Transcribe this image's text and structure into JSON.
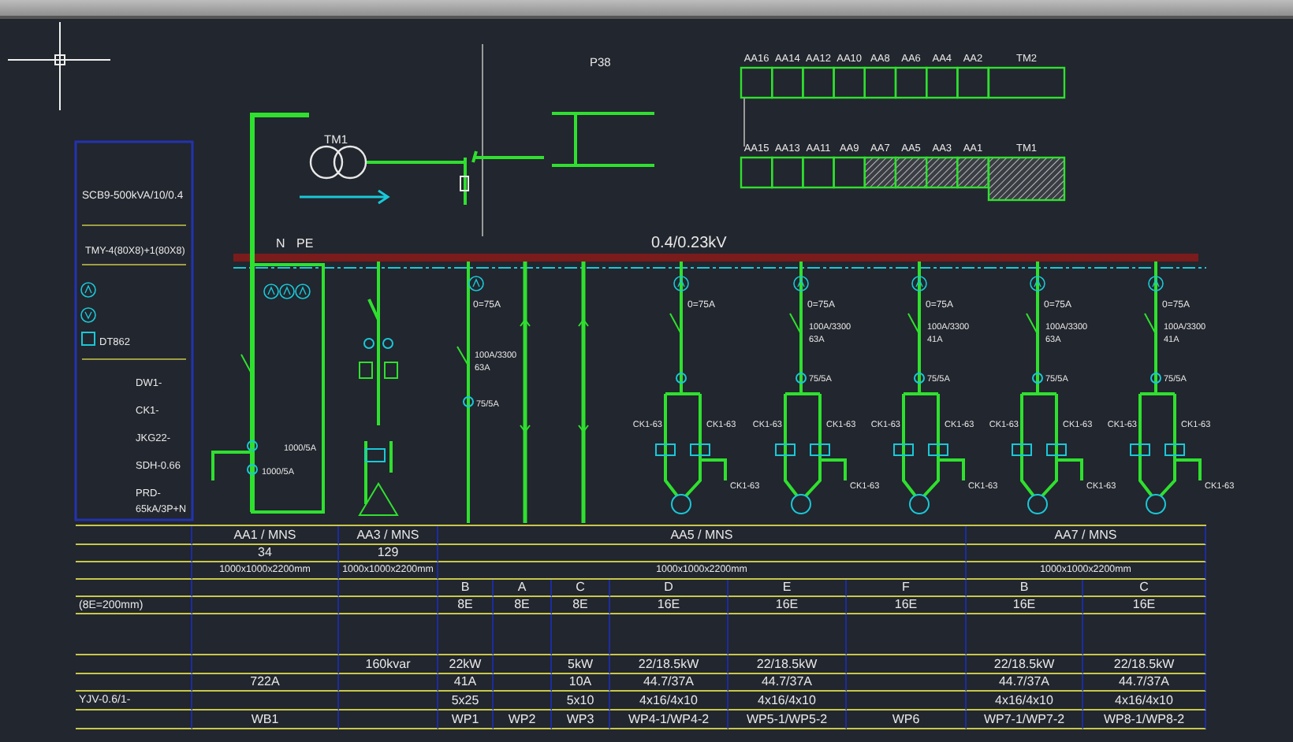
{
  "hv_section": {
    "transformer_label": "TM1",
    "reference": "P38"
  },
  "legend": {
    "transformer": "SCB9-500kVA/10/0.4",
    "busbar": "TMY-4(80X8)+1(80X8)",
    "meter": "DT862",
    "devices": [
      "DW1-",
      "CK1-",
      "JKG22-",
      "SDH-0.66",
      "PRD-"
    ],
    "surge_rating": "65kA/3P+N"
  },
  "busbar": {
    "voltage": "0.4/0.23kV",
    "neutral": "N",
    "earth": "PE"
  },
  "layout_plan": {
    "top_row": [
      {
        "label": "AA16",
        "hatched": false
      },
      {
        "label": "AA14",
        "hatched": false
      },
      {
        "label": "AA12",
        "hatched": false
      },
      {
        "label": "AA10",
        "hatched": false
      },
      {
        "label": "AA8",
        "hatched": false
      },
      {
        "label": "AA6",
        "hatched": false
      },
      {
        "label": "AA4",
        "hatched": false
      },
      {
        "label": "AA2",
        "hatched": false
      },
      {
        "label": "TM2",
        "hatched": false
      }
    ],
    "bottom_row": [
      {
        "label": "AA15",
        "hatched": false
      },
      {
        "label": "AA13",
        "hatched": false
      },
      {
        "label": "AA11",
        "hatched": false
      },
      {
        "label": "AA9",
        "hatched": false
      },
      {
        "label": "AA7",
        "hatched": true
      },
      {
        "label": "AA5",
        "hatched": true
      },
      {
        "label": "AA3",
        "hatched": true
      },
      {
        "label": "AA1",
        "hatched": true
      },
      {
        "label": "TM1",
        "hatched": true
      }
    ]
  },
  "feeders": [
    {
      "kind": "incomer",
      "ct_labels": [
        "1000/5A",
        "1000/5A"
      ]
    },
    {
      "kind": "capacitor"
    },
    {
      "kind": "feeder",
      "reading": "0=75A",
      "breaker": "100A/3300",
      "rating": "63A",
      "ct": "75/5A"
    },
    {
      "kind": "riser"
    },
    {
      "kind": "riser"
    },
    {
      "kind": "motor",
      "reading": "0=75A",
      "contactors": [
        "CK1-63",
        "CK1-63"
      ],
      "bypass": "CK1-63"
    },
    {
      "kind": "motor",
      "reading": "0=75A",
      "breaker": "100A/3300",
      "rating": "63A",
      "ct": "75/5A",
      "contactors": [
        "CK1-63",
        "CK1-63"
      ],
      "bypass": "CK1-63"
    },
    {
      "kind": "motor",
      "reading": "0=75A",
      "breaker": "100A/3300",
      "rating": "41A",
      "ct": "75/5A",
      "contactors": [
        "CK1-63",
        "CK1-63"
      ],
      "bypass": "CK1-63"
    },
    {
      "kind": "motor",
      "reading": "0=75A",
      "breaker": "100A/3300",
      "rating": "63A",
      "ct": "75/5A",
      "contactors": [
        "CK1-63",
        "CK1-63"
      ],
      "bypass": "CK1-63"
    },
    {
      "kind": "motor",
      "reading": "0=75A",
      "breaker": "100A/3300",
      "rating": "41A",
      "ct": "75/5A",
      "contactors": [
        "CK1-63",
        "CK1-63"
      ],
      "bypass": "CK1-63"
    }
  ],
  "table": {
    "width_label": "(8E=200mm)",
    "cable_label": "YJV-0.6/1-",
    "panels": [
      {
        "name": "AA1 / MNS",
        "number": "34",
        "size": "1000x1000x2200mm",
        "circuits": [
          {
            "current": "722A",
            "cable_no": "WB1"
          }
        ]
      },
      {
        "name": "AA3 / MNS",
        "number": "129",
        "size": "1000x1000x2200mm",
        "circuits": [
          {
            "power": "160kvar"
          }
        ]
      },
      {
        "name": "AA5 / MNS",
        "size": "1000x1000x2200mm",
        "circuits": [
          {
            "drawer": "B",
            "width": "8E",
            "power": "22kW",
            "current": "41A",
            "cable": "5x25",
            "cable_no": "WP1"
          },
          {
            "drawer": "A",
            "width": "8E",
            "cable_no": "WP2"
          },
          {
            "drawer": "C",
            "width": "8E",
            "power": "5kW",
            "current": "10A",
            "cable": "5x10",
            "cable_no": "WP3"
          },
          {
            "drawer": "D",
            "width": "16E",
            "power": "22/18.5kW",
            "current": "44.7/37A",
            "cable": "4x16/4x10",
            "cable_no": "WP4-1/WP4-2"
          },
          {
            "drawer": "E",
            "width": "16E",
            "power": "22/18.5kW",
            "current": "44.7/37A",
            "cable": "4x16/4x10",
            "cable_no": "WP5-1/WP5-2"
          },
          {
            "drawer": "F",
            "width": "16E",
            "cable_no": "WP6"
          }
        ]
      },
      {
        "name": "AA7 / MNS",
        "size": "1000x1000x2200mm",
        "circuits": [
          {
            "drawer": "B",
            "width": "16E",
            "power": "22/18.5kW",
            "current": "44.7/37A",
            "cable": "4x16/4x10",
            "cable_no": "WP7-1/WP7-2"
          },
          {
            "drawer": "C",
            "width": "16E",
            "power": "22/18.5kW",
            "current": "44.7/37A",
            "cable": "4x16/4x10",
            "cable_no": "WP8-1/WP8-2"
          }
        ]
      }
    ]
  }
}
